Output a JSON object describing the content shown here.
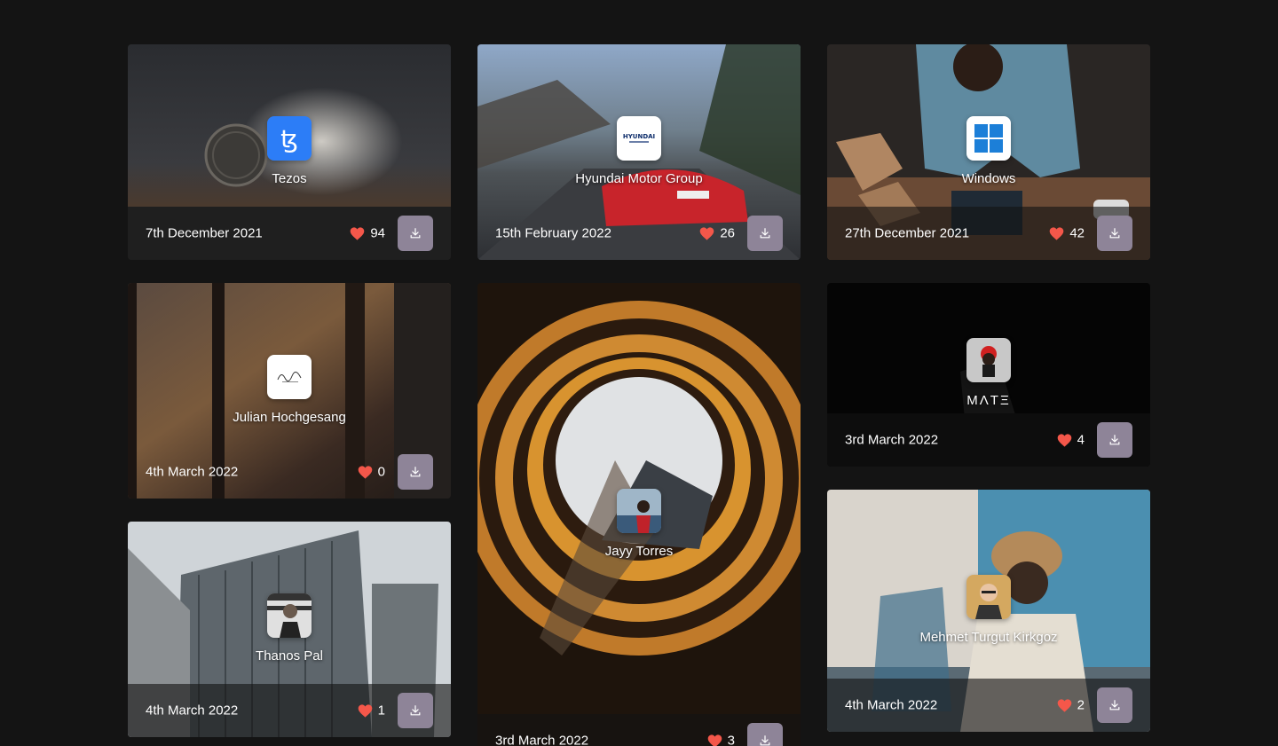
{
  "colors": {
    "page_background": "#141414",
    "like_heart": "#f4574a",
    "download_button": "#8e8498"
  },
  "cards": [
    {
      "author": "Tezos",
      "date": "7th December 2021",
      "likes": "94",
      "avatar_icon": "tezos-logo-icon"
    },
    {
      "author": "Hyundai Motor Group",
      "date": "15th February 2022",
      "likes": "26",
      "avatar_icon": "hyundai-logo-icon"
    },
    {
      "author": "Windows",
      "date": "27th December 2021",
      "likes": "42",
      "avatar_icon": "windows-logo-icon"
    },
    {
      "author": "Julian Hochgesang",
      "date": "4th March 2022",
      "likes": "0",
      "avatar_icon": "signature-logo-icon"
    },
    {
      "author": "Jayy Torres",
      "date": "3rd March 2022",
      "likes": "3",
      "avatar_icon": "user-avatar"
    },
    {
      "author": "MΛTΞ",
      "date": "3rd March 2022",
      "likes": "4",
      "avatar_icon": "user-avatar"
    },
    {
      "author": "Thanos Pal",
      "date": "4th March 2022",
      "likes": "1",
      "avatar_icon": "user-avatar"
    },
    {
      "author": "Mehmet Turgut Kirkgoz",
      "date": "4th March 2022",
      "likes": "2",
      "avatar_icon": "user-avatar"
    }
  ]
}
